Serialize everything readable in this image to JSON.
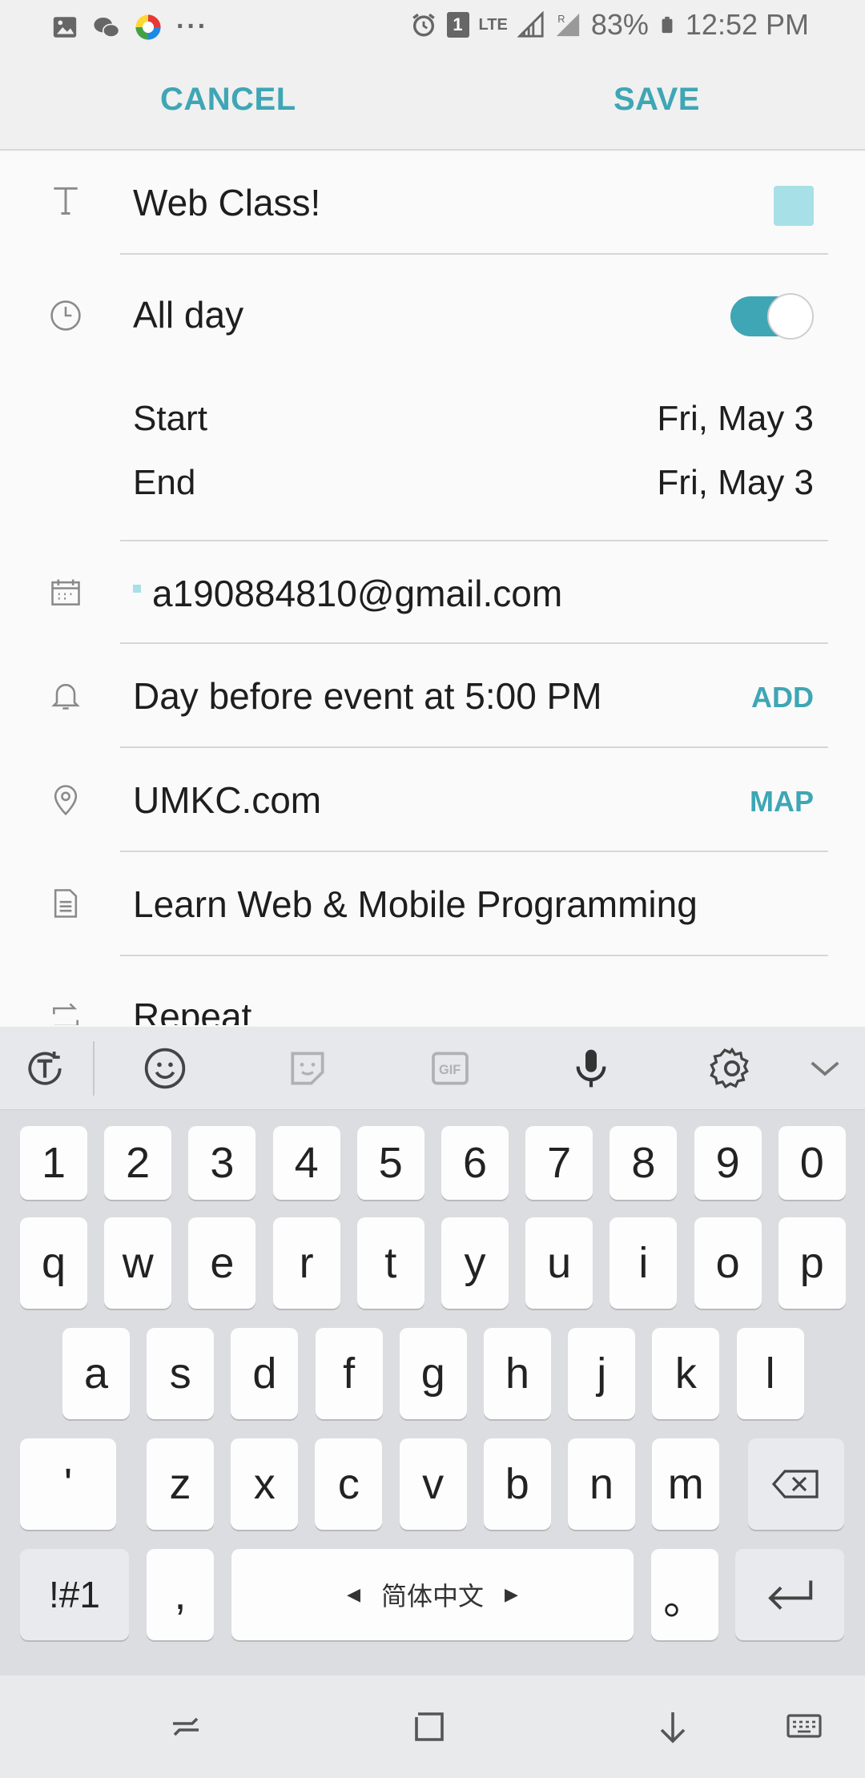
{
  "status_bar": {
    "battery": "83%",
    "time": "12:52 PM",
    "network": "LTE",
    "sim_badge": "1",
    "overflow": "···",
    "icons": [
      "image-icon",
      "wechat-icon",
      "app-icon",
      "alarm-icon",
      "sim-icon",
      "signal-icon",
      "battery-icon"
    ]
  },
  "action_bar": {
    "cancel_label": "CANCEL",
    "save_label": "SAVE",
    "accent_color": "#3ea6b5"
  },
  "form": {
    "title": {
      "value": "Web Class!",
      "color": "#a7e0e6"
    },
    "all_day": {
      "label": "All day",
      "enabled": true
    },
    "start": {
      "label": "Start",
      "value": "Fri, May 3"
    },
    "end": {
      "label": "End",
      "value": "Fri, May 3"
    },
    "calendar": {
      "account": "a190884810@gmail.com"
    },
    "reminder": {
      "text": "Day before event at 5:00 PM",
      "action": "ADD"
    },
    "location": {
      "text": "UMKC.com",
      "action": "MAP"
    },
    "notes": {
      "text": "Learn Web & Mobile Programming"
    },
    "repeat": {
      "label": "Repeat"
    }
  },
  "keyboard": {
    "toolbar_icons": [
      "text-mode-icon",
      "emoji-icon",
      "sticker-icon",
      "gif-icon",
      "microphone-icon",
      "settings-icon",
      "collapse-icon"
    ],
    "row_numbers": [
      "1",
      "2",
      "3",
      "4",
      "5",
      "6",
      "7",
      "8",
      "9",
      "0"
    ],
    "row_top": [
      "q",
      "w",
      "e",
      "r",
      "t",
      "y",
      "u",
      "i",
      "o",
      "p"
    ],
    "row_middle": [
      "a",
      "s",
      "d",
      "f",
      "g",
      "h",
      "j",
      "k",
      "l"
    ],
    "row_bottom": [
      "'",
      "z",
      "x",
      "c",
      "v",
      "b",
      "n",
      "m"
    ],
    "symbols_label": "!#1",
    "comma_label": ",",
    "space_label": "简体中文",
    "period_label": "。"
  },
  "nav_bar": {
    "icons": [
      "recents-icon",
      "home-icon",
      "back-icon",
      "keyboard-switch-icon"
    ]
  }
}
